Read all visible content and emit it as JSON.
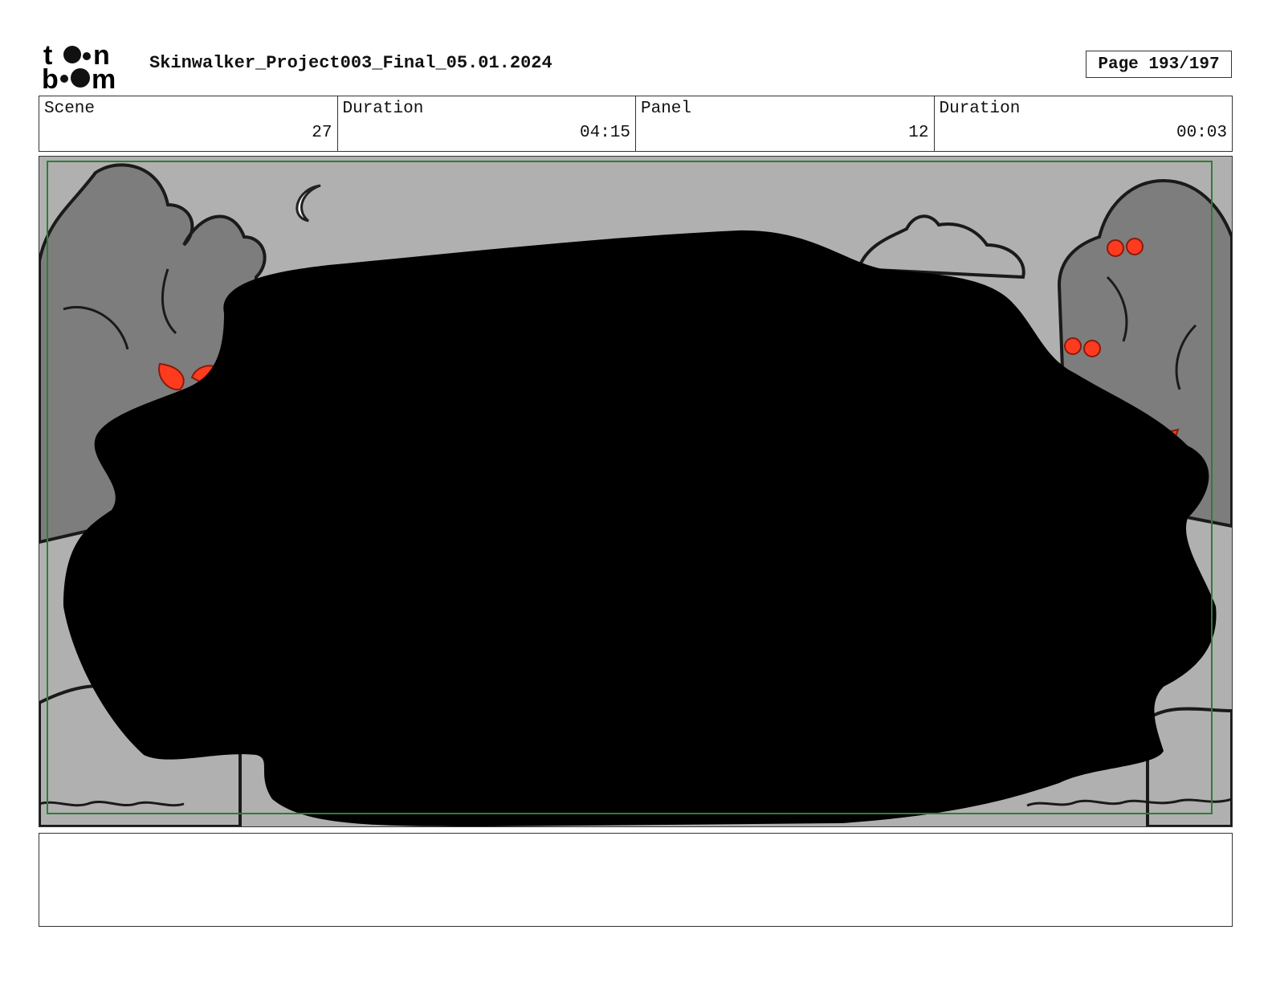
{
  "header": {
    "logo_text": "toonboom",
    "title": "Skinwalker_Project003_Final_05.01.2024",
    "page_label": "Page 193/197"
  },
  "info": {
    "scene_label": "Scene",
    "scene_value": "27",
    "scene_duration_label": "Duration",
    "scene_duration_value": "04:15",
    "panel_label": "Panel",
    "panel_value": "12",
    "panel_duration_label": "Duration",
    "panel_duration_value": "00:03"
  },
  "colors": {
    "sky": "#b0b0b0",
    "trees": "#7d7d7d",
    "eyes": "#ff3b1f",
    "safe_frame": "#2e7d32",
    "redaction": "#000000"
  },
  "notes": {
    "text": ""
  }
}
